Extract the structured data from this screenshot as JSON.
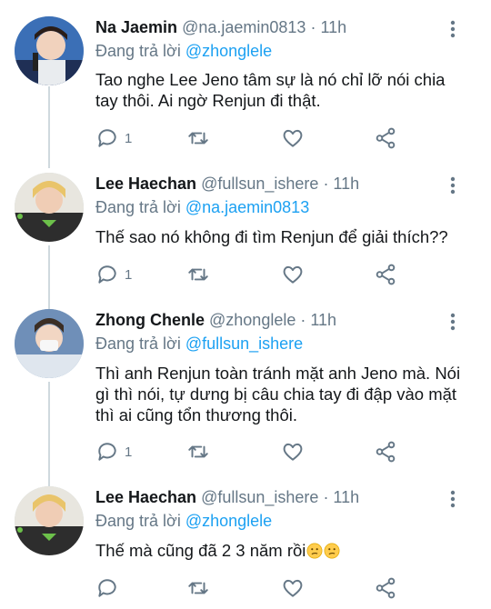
{
  "colors": {
    "accent": "#1da1f2",
    "muted": "#657786",
    "text": "#14171a",
    "line": "#cfd9de"
  },
  "tweets": [
    {
      "name": "Na Jaemin",
      "handle": "@na.jaemin0813",
      "time": "· 11h",
      "reply_prefix": "Đang trả lời ",
      "reply_to": "@zhonglele",
      "text": "Tao nghe Lee Jeno tâm sự là nó chỉ lỡ nói chia tay thôi. Ai ngờ Renjun đi thật.",
      "reply_count": "1"
    },
    {
      "name": "Lee Haechan",
      "handle": "@fullsun_ishere",
      "time": "· 11h",
      "reply_prefix": "Đang trả lời ",
      "reply_to": "@na.jaemin0813",
      "text": "Thế sao nó không đi tìm Renjun để giải thích??",
      "reply_count": "1"
    },
    {
      "name": "Zhong Chenle",
      "handle": "@zhonglele",
      "time": "· 11h",
      "reply_prefix": "Đang trả lời ",
      "reply_to": "@fullsun_ishere",
      "text": "Thì anh Renjun toàn tránh mặt anh Jeno mà. Nói gì thì nói, tự dưng bị câu chia tay đi đập vào mặt thì ai cũng tổn thương thôi.",
      "reply_count": "1"
    },
    {
      "name": "Lee Haechan",
      "handle": "@fullsun_ishere",
      "time": "· 11h",
      "reply_prefix": "Đang trả lời ",
      "reply_to": "@zhonglele",
      "text": "Thế mà cũng đã 2 3 năm rồi",
      "reply_count": ""
    }
  ],
  "icons": {
    "reply": "reply-icon",
    "retweet": "retweet-icon",
    "like": "heart-icon",
    "share": "share-icon",
    "more": "more-vertical-icon",
    "emoji": "confused-face-emoji"
  }
}
